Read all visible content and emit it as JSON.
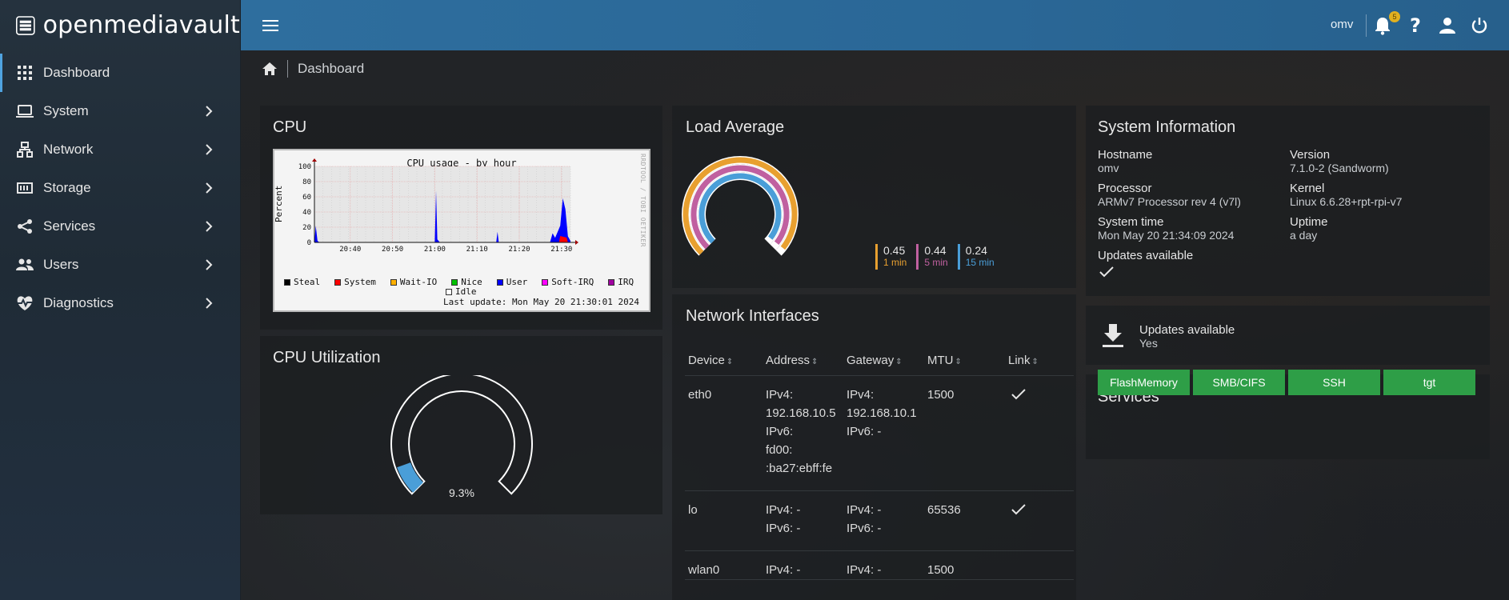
{
  "app": {
    "name": "openmediavault"
  },
  "sidebar": {
    "items": [
      {
        "label": "Dashboard",
        "icon": "grid-icon"
      },
      {
        "label": "System",
        "icon": "laptop-icon"
      },
      {
        "label": "Network",
        "icon": "network-icon"
      },
      {
        "label": "Storage",
        "icon": "storage-icon"
      },
      {
        "label": "Services",
        "icon": "share-icon"
      },
      {
        "label": "Users",
        "icon": "users-icon"
      },
      {
        "label": "Diagnostics",
        "icon": "heart-pulse-icon"
      }
    ]
  },
  "topbar": {
    "user": "omv",
    "notification_count": "5"
  },
  "breadcrumb": {
    "current": "Dashboard"
  },
  "cpu": {
    "title": "CPU",
    "chart_data": {
      "type": "area",
      "title": "CPU usage - by hour",
      "ylabel": "Percent",
      "watermark": "RRDTOOL / TOBI OETIKER",
      "yticks": [
        "100",
        "80",
        "60",
        "40",
        "20",
        "0"
      ],
      "xticks": [
        "20:40",
        "20:50",
        "21:00",
        "21:10",
        "21:20",
        "21:30"
      ],
      "ylim": [
        0,
        100
      ],
      "legend": [
        {
          "name": "Steal",
          "color": "#000000"
        },
        {
          "name": "System",
          "color": "#ff0000"
        },
        {
          "name": "Wait-IO",
          "color": "#ffb000"
        },
        {
          "name": "Nice",
          "color": "#00c000"
        },
        {
          "name": "User",
          "color": "#0000ff"
        },
        {
          "name": "Soft-IRQ",
          "color": "#ff00ff"
        },
        {
          "name": "IRQ",
          "color": "#a000a0"
        }
      ],
      "idle_label": "Idle",
      "last_update": "Last update: Mon May 20 21:30:01 2024"
    }
  },
  "cpu_util": {
    "title": "CPU Utilization",
    "value": "9.3%",
    "fraction": 0.093
  },
  "load": {
    "title": "Load Average",
    "values": [
      {
        "value": "0.45",
        "label": "1 min",
        "color": "#e8a030"
      },
      {
        "value": "0.44",
        "label": "5 min",
        "color": "#c060a0"
      },
      {
        "value": "0.24",
        "label": "15 min",
        "color": "#4a9ed8"
      }
    ]
  },
  "network": {
    "title": "Network Interfaces",
    "headers": [
      "Device",
      "Address",
      "Gateway",
      "MTU",
      "Link"
    ],
    "rows": [
      {
        "device": "eth0",
        "address": [
          "IPv4:",
          "192.168.10.5",
          "IPv6:",
          "fd00:",
          ":ba27:ebff:fe"
        ],
        "gateway": [
          "IPv4:",
          "192.168.10.1",
          "IPv6: -"
        ],
        "mtu": "1500",
        "link": true
      },
      {
        "device": "lo",
        "address": [
          "IPv4: -",
          "IPv6: -"
        ],
        "gateway": [
          "IPv4: -",
          "IPv6: -"
        ],
        "mtu": "65536",
        "link": true
      },
      {
        "device": "wlan0",
        "address": [
          "IPv4: -"
        ],
        "gateway": [
          "IPv4: -"
        ],
        "mtu": "1500",
        "link": false
      }
    ]
  },
  "sysinfo": {
    "title": "System Information",
    "hostname_label": "Hostname",
    "hostname": "omv",
    "version_label": "Version",
    "version": "7.1.0-2 (Sandworm)",
    "processor_label": "Processor",
    "processor": "ARMv7 Processor rev 4 (v7l)",
    "kernel_label": "Kernel",
    "kernel": "Linux 6.6.28+rpt-rpi-v7",
    "time_label": "System time",
    "time": "Mon May 20 21:34:09 2024",
    "uptime_label": "Uptime",
    "uptime": "a day",
    "updates_label": "Updates available"
  },
  "updates_card": {
    "label": "Updates available",
    "value": "Yes"
  },
  "services": {
    "title": "Services",
    "items": [
      "FlashMemory",
      "SMB/CIFS",
      "SSH",
      "tgt"
    ],
    "color": "#2e9e47"
  }
}
